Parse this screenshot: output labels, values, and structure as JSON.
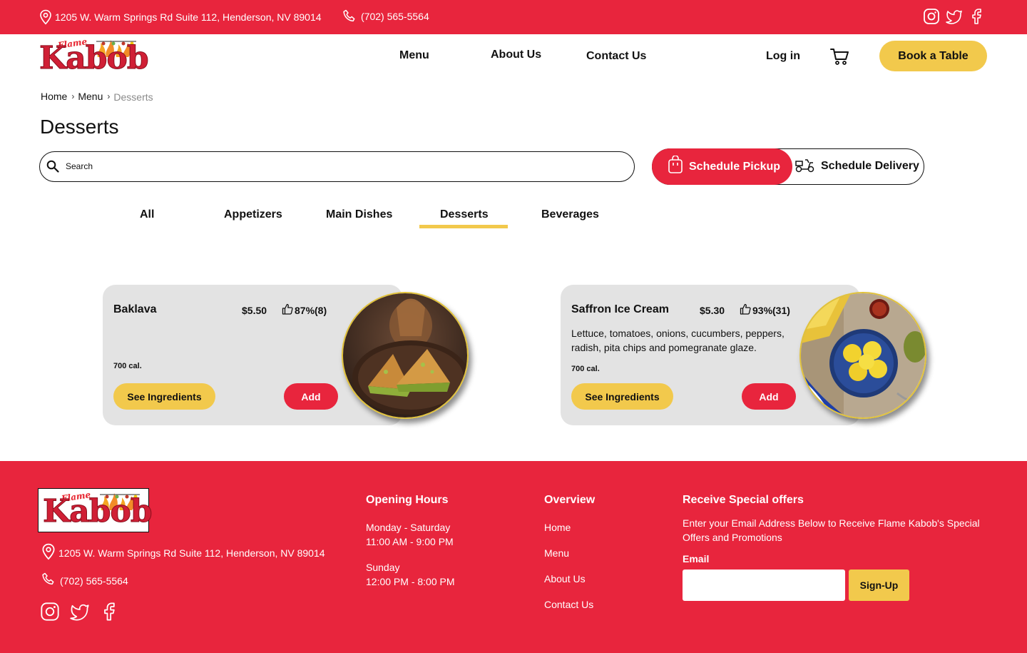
{
  "topbar": {
    "address": "1205 W. Warm Springs Rd Suite 112, Henderson, NV 89014",
    "phone": "(702) 565-5564",
    "social_icons": [
      "instagram-icon",
      "twitter-icon",
      "facebook-icon"
    ]
  },
  "brand": {
    "logo_small_word": "Flame",
    "logo_big_word": "Kabob"
  },
  "nav": {
    "items": [
      "Menu",
      "About Us",
      "Contact Us"
    ],
    "login": "Log in",
    "book_table": "Book a Table"
  },
  "breadcrumb": [
    "Home",
    "Menu",
    "Desserts"
  ],
  "page_title": "Desserts",
  "search": {
    "placeholder": "Search"
  },
  "schedule": {
    "pickup": "Schedule Pickup",
    "delivery": "Schedule Delivery",
    "selected": "pickup"
  },
  "tabs": {
    "items": [
      "All",
      "Appetizers",
      "Main Dishes",
      "Desserts",
      "Beverages"
    ],
    "active": "Desserts"
  },
  "products": [
    {
      "name": "Baklava",
      "price": "$5.50",
      "rating": "87%(8)",
      "description": "",
      "calories": "700 cal.",
      "ingredients_label": "See Ingredients",
      "add_label": "Add"
    },
    {
      "name": "Saffron Ice Cream",
      "price": "$5.30",
      "rating": "93%(31)",
      "description": "Lettuce, tomatoes, onions, cucumbers, peppers, radish, pita chips and pomegranate glaze.",
      "calories": "700 cal.",
      "ingredients_label": "See Ingredients",
      "add_label": "Add"
    }
  ],
  "footer": {
    "address": "1205 W. Warm Springs Rd Suite 112, Henderson, NV 89014",
    "phone": "(702) 565-5564",
    "hours_title": "Opening Hours",
    "hours": [
      {
        "days": "Monday - Saturday",
        "time": "11:00 AM - 9:00 PM"
      },
      {
        "days": "Sunday",
        "time": "12:00 PM - 8:00 PM"
      }
    ],
    "overview_title": "Overview",
    "overview_links": [
      "Home",
      "Menu",
      "About Us",
      "Contact Us"
    ],
    "offers_title": "Receive Special offers",
    "offers_text": "Enter your Email Address Below to Receive Flame Kabob's Special Offers and Promotions",
    "email_label": "Email",
    "email_value": "",
    "signup_label": "Sign-Up"
  },
  "colors": {
    "brand_red": "#e8253d",
    "accent_yellow": "#f2c94c",
    "card_gray": "#e3e3e3"
  }
}
